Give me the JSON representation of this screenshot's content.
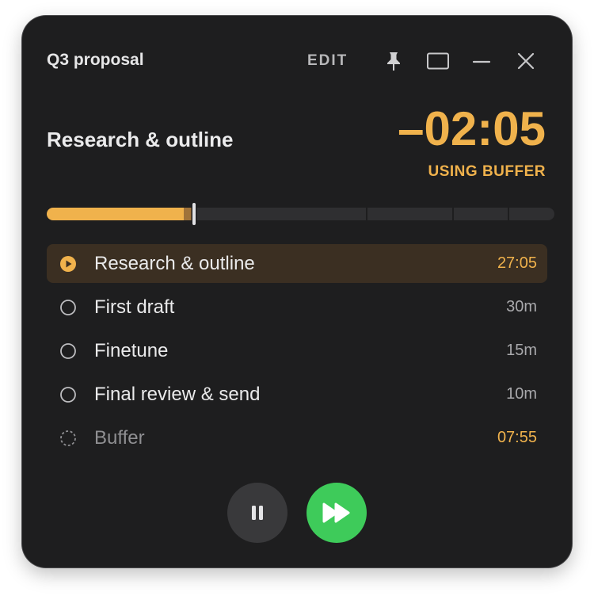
{
  "window": {
    "title": "Q3 proposal",
    "edit_label": "EDIT",
    "controls": [
      "pin-icon",
      "maximize-icon",
      "minimize-icon",
      "close-icon"
    ]
  },
  "current": {
    "task_title": "Research & outline",
    "time_display": "–02:05",
    "status": "USING BUFFER"
  },
  "progress": {
    "completed_fraction": 0.27,
    "overrun_fraction": 0.02,
    "segment_boundaries": [
      0.27,
      0.63,
      0.8,
      0.91
    ],
    "accent_color": "#f0b24c"
  },
  "tasks": [
    {
      "name": "Research & outline",
      "duration": "27:05",
      "state": "active",
      "icon": "play-circle-icon"
    },
    {
      "name": "First draft",
      "duration": "30m",
      "state": "pending",
      "icon": "empty-circle-icon"
    },
    {
      "name": "Finetune",
      "duration": "15m",
      "state": "pending",
      "icon": "empty-circle-icon"
    },
    {
      "name": "Final review & send",
      "duration": "10m",
      "state": "pending",
      "icon": "empty-circle-icon"
    },
    {
      "name": "Buffer",
      "duration": "07:55",
      "state": "buffer",
      "icon": "dashed-circle-icon"
    }
  ],
  "controls": {
    "pause_icon": "pause-icon",
    "skip_icon": "fast-forward-icon",
    "skip_color": "#3ecb5a"
  }
}
